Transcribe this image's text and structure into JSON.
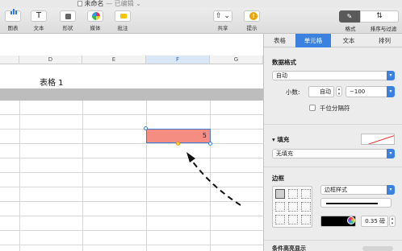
{
  "window": {
    "doc_title": "未命名",
    "doc_status": "— 已编辑",
    "title_chevron": "⌄"
  },
  "toolbar": {
    "chart_label": "图表",
    "text_label": "文本",
    "shape_label": "形状",
    "media_label": "媒体",
    "comment_label": "批注",
    "share_label": "共享",
    "tips_label": "提示",
    "format_label": "格式",
    "sort_filter_label": "排序与过滤",
    "text_glyph": "T",
    "share_glyph": "⇧ ⌄",
    "tips_glyph": "!",
    "sort_glyph": "⇅"
  },
  "sheet": {
    "columns": [
      "D",
      "E",
      "F",
      "G"
    ],
    "selected_column": "F",
    "table_title": "表格 1",
    "selected_cell_value": "5",
    "colors": {
      "cell_fill": "#f58d83",
      "selection": "#3c7bd6",
      "header_band": "#bdbdbd"
    }
  },
  "panel": {
    "tabs": [
      {
        "label": "表格",
        "active": false
      },
      {
        "label": "单元格",
        "active": true
      },
      {
        "label": "文本",
        "active": false
      },
      {
        "label": "排列",
        "active": false
      }
    ],
    "data_format": {
      "heading": "数据格式",
      "value": "自动",
      "decimals_label": "小数:",
      "decimals_value": "自动",
      "negative_value": "−100",
      "thousands_label": "千位分隔符",
      "thousands_checked": false
    },
    "fill": {
      "heading": "填充",
      "disclosure": "▾",
      "value": "无填充"
    },
    "border": {
      "heading": "边框",
      "style_value": "边框样式",
      "width_value": "0.35 磅",
      "color": "#000000"
    },
    "next_section": "条件高亮显示",
    "accent_color": "#3b82e0"
  }
}
